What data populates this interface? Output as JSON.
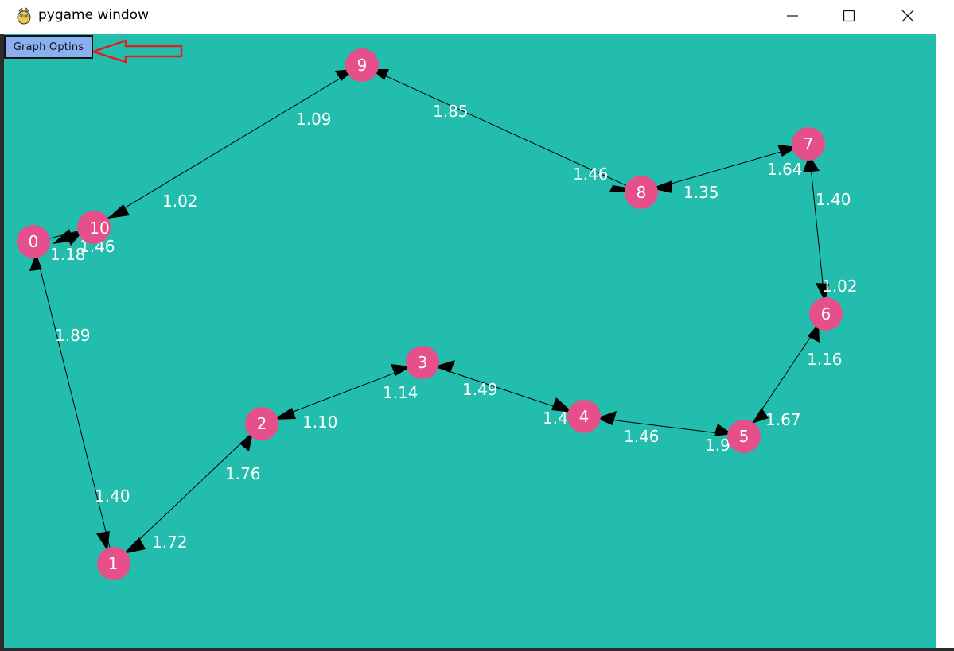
{
  "window": {
    "title": "pygame window",
    "controls": [
      "minimize",
      "maximize",
      "close"
    ]
  },
  "colors": {
    "background": "#22bdad",
    "node_fill": "#e6508a",
    "edge": "#000000",
    "label_text": "#ffffff",
    "button_fill": "#8ab0f0",
    "annotation_arrow": "#e02020"
  },
  "menu": {
    "graph_options_label": "Graph Optins"
  },
  "graph": {
    "nodes": [
      {
        "id": "0",
        "label": "0"
      },
      {
        "id": "1",
        "label": "1"
      },
      {
        "id": "2",
        "label": "2"
      },
      {
        "id": "3",
        "label": "3"
      },
      {
        "id": "4",
        "label": "4"
      },
      {
        "id": "5",
        "label": "5"
      },
      {
        "id": "6",
        "label": "6"
      },
      {
        "id": "7",
        "label": "7"
      },
      {
        "id": "8",
        "label": "8"
      },
      {
        "id": "9",
        "label": "9"
      },
      {
        "id": "10",
        "label": "10"
      }
    ],
    "edges": [
      {
        "from": "0",
        "to": "10"
      },
      {
        "from": "10",
        "to": "9"
      },
      {
        "from": "9",
        "to": "8"
      },
      {
        "from": "8",
        "to": "7"
      },
      {
        "from": "7",
        "to": "6"
      },
      {
        "from": "6",
        "to": "5"
      },
      {
        "from": "5",
        "to": "4"
      },
      {
        "from": "4",
        "to": "3"
      },
      {
        "from": "3",
        "to": "2"
      },
      {
        "from": "2",
        "to": "1"
      },
      {
        "from": "1",
        "to": "0"
      }
    ],
    "weights": [
      "1.09",
      "1.85",
      "1.46",
      "1.64",
      "1.35",
      "1.40",
      "1.02",
      "1.18",
      "1.46",
      "1.02",
      "1.89",
      "1.16",
      "1.14",
      "1.49",
      "1.10",
      "1.4",
      "1.46",
      "1.67",
      "1.9",
      "1.76",
      "1.40",
      "1.72"
    ]
  }
}
